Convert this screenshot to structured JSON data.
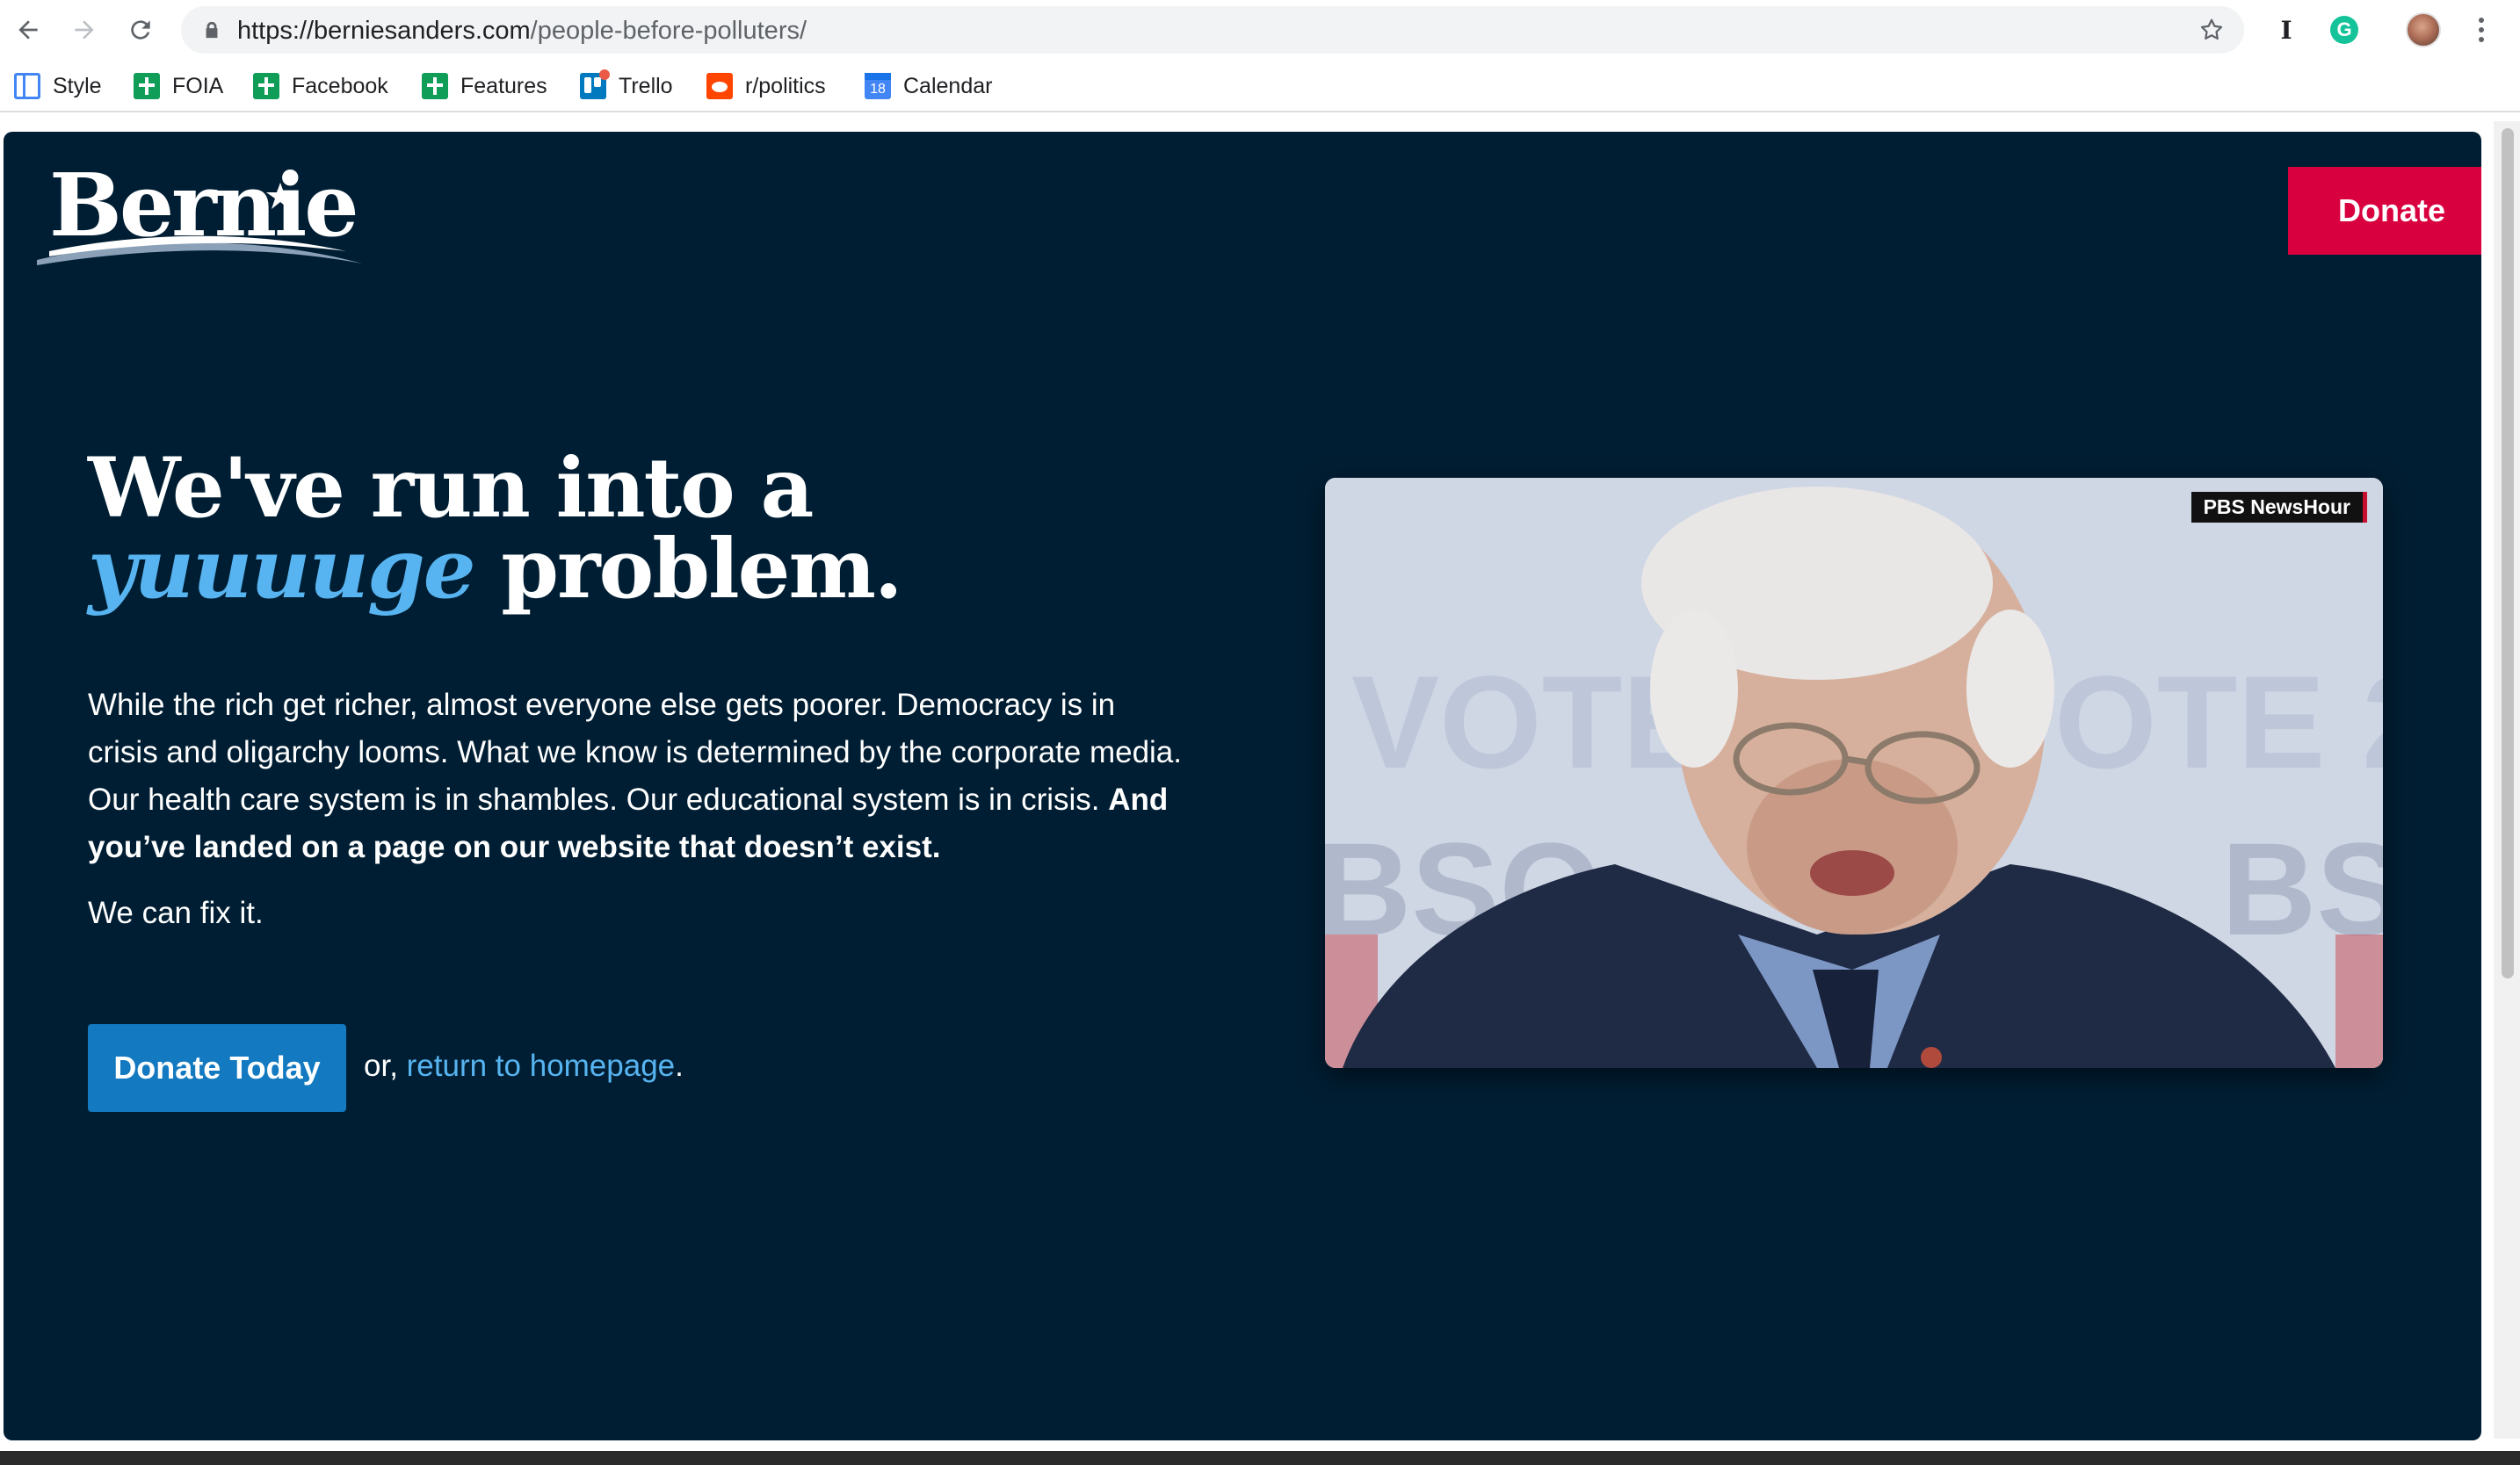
{
  "browser": {
    "url_host": "https://berniesanders.com",
    "url_path": "/people-before-polluters/",
    "icons": [
      "back-icon",
      "forward-icon",
      "reload-icon",
      "lock-icon",
      "star-icon",
      "instapaper-icon",
      "grammarly-icon",
      "profile-avatar",
      "menu-icon"
    ],
    "extension_i_label": "I",
    "extension_g_label": "G",
    "bookmarks": [
      {
        "label": "Style",
        "icon": "docs-icon"
      },
      {
        "label": "FOIA",
        "icon": "sheets-icon"
      },
      {
        "label": "Facebook",
        "icon": "sheets-icon"
      },
      {
        "label": "Features",
        "icon": "sheets-icon"
      },
      {
        "label": "Trello",
        "icon": "trello-icon"
      },
      {
        "label": "r/politics",
        "icon": "reddit-icon"
      },
      {
        "label": "Calendar",
        "icon": "calendar-icon",
        "badge": "18"
      }
    ]
  },
  "page": {
    "logo_text": "Bernie",
    "header_donate": "Donate",
    "headline_line1": "We've run into a",
    "headline_emph": "yuuuuge",
    "headline_rest": "problem.",
    "body_plain": "While the rich get richer, almost everyone else gets poorer. Democracy is in crisis and oligarchy looms. What we know is determined by the corporate media. Our health care system is in shambles. Our educational system is in crisis.",
    "body_bold": "And you’ve landed on a page on our website that doesn’t exist.",
    "fix_line": "We can fix it.",
    "cta_button": "Donate Today",
    "or_prefix": "or,",
    "homepage_link": "return to homepage",
    "or_suffix": ".",
    "video_badge": "PBS NewsHour",
    "colors": {
      "background": "#001e33",
      "accent_blue": "#57b4f0",
      "donate_red": "#d8003f",
      "cta_blue": "#1379c0"
    }
  }
}
